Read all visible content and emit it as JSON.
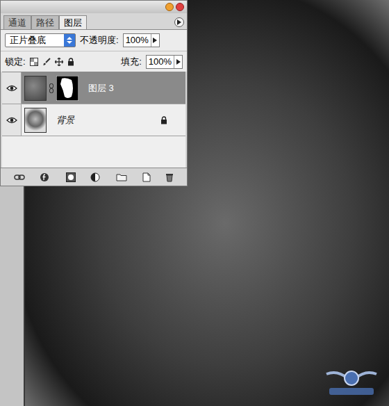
{
  "panel": {
    "tabs": [
      {
        "label": "通道",
        "selected": false
      },
      {
        "label": "路径",
        "selected": false
      },
      {
        "label": "图层",
        "selected": true
      }
    ],
    "blend_mode": "正片叠底",
    "opacity": {
      "label": "不透明度:",
      "value": "100%"
    },
    "lock": {
      "label": "锁定:"
    },
    "fill": {
      "label": "填充:",
      "value": "100%"
    },
    "layers": [
      {
        "name": "图层 3",
        "selected": true,
        "visible": true,
        "has_mask": true,
        "locked": false,
        "kind": "texture"
      },
      {
        "name": "背景",
        "selected": false,
        "visible": true,
        "has_mask": false,
        "locked": true,
        "kind": "photo"
      }
    ]
  }
}
